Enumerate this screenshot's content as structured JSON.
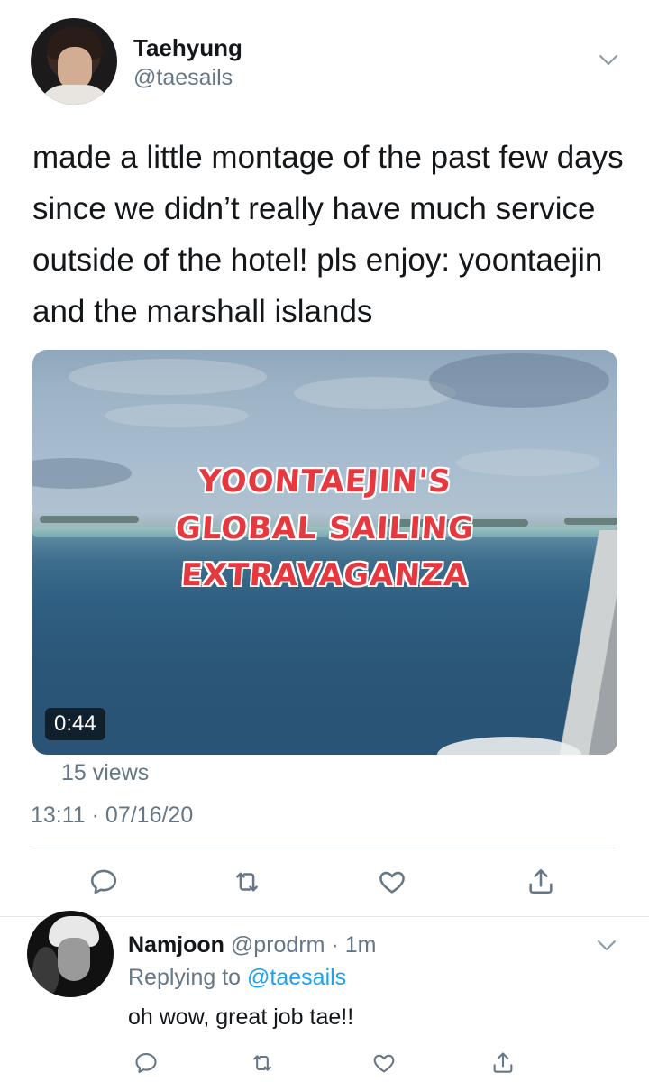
{
  "tweet": {
    "author_name": "Taehyung",
    "author_handle": "@taesails",
    "text": "made a little montage of the past few days since we didn’t really have much service outside of the hotel! pls enjoy: yoontaejin and the marshall islands",
    "video": {
      "title_lines": [
        "YOONTAEJIN'S",
        "GLOBAL SAILING",
        "EXTRAVAGANZA"
      ],
      "duration": "0:44"
    },
    "views": "15 views",
    "timestamp": "13:11 · 07/16/20",
    "menu_icon": "chevron-down-icon"
  },
  "actions": [
    {
      "name": "reply",
      "icon": "comment-icon"
    },
    {
      "name": "retweet",
      "icon": "retweet-icon"
    },
    {
      "name": "like",
      "icon": "heart-icon"
    },
    {
      "name": "share",
      "icon": "share-icon"
    }
  ],
  "reply": {
    "author_name": "Namjoon",
    "meta": "@prodrm · 1m",
    "replying_prefix": "Replying to",
    "replying_handle": "@taesails",
    "text": "oh wow, great job tae!!"
  },
  "colors": {
    "text": "#14171a",
    "secondary": "#657786",
    "link": "#1da1f2",
    "divider": "#e1e8ed",
    "video_title": "#e5383f"
  }
}
